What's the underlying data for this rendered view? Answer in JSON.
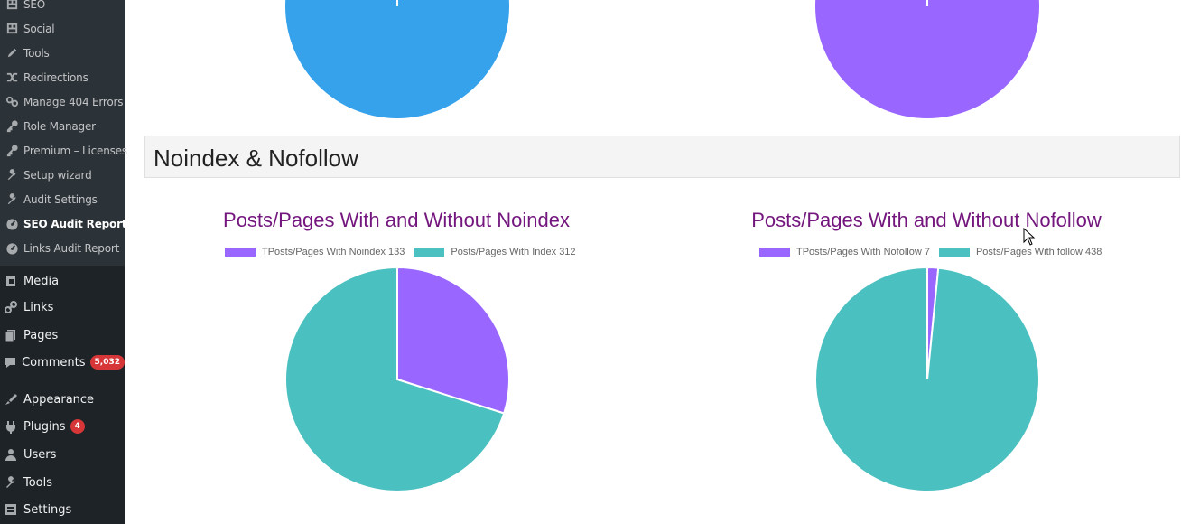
{
  "sidebar": {
    "submenu": [
      {
        "label": "SEO",
        "icon": "grid-icon"
      },
      {
        "label": "Social",
        "icon": "grid-icon"
      },
      {
        "label": "Tools",
        "icon": "pencil-icon"
      },
      {
        "label": "Redirections",
        "icon": "shuffle-icon"
      },
      {
        "label": "Manage 404 Errors",
        "icon": "broken-link-icon"
      },
      {
        "label": "Role Manager",
        "icon": "key-icon"
      },
      {
        "label": "Premium – Licenses",
        "icon": "key-icon"
      },
      {
        "label": "Setup wizard",
        "icon": "wrench-icon"
      },
      {
        "label": "Audit Settings",
        "icon": "wrench-icon"
      },
      {
        "label": "SEO Audit Report",
        "icon": "dashboard-icon",
        "current": true
      },
      {
        "label": "Links Audit Report",
        "icon": "dashboard-icon"
      }
    ],
    "menu": [
      {
        "label": "Media",
        "icon": "media-icon"
      },
      {
        "label": "Links",
        "icon": "link-icon"
      },
      {
        "label": "Pages",
        "icon": "pages-icon"
      },
      {
        "label": "Comments",
        "icon": "comment-icon",
        "badge": "5,032"
      },
      {
        "label": "Appearance",
        "icon": "brush-icon"
      },
      {
        "label": "Plugins",
        "icon": "plugin-icon",
        "badge": "4"
      },
      {
        "label": "Users",
        "icon": "user-icon"
      },
      {
        "label": "Tools",
        "icon": "wrench-icon"
      },
      {
        "label": "Settings",
        "icon": "settings-icon"
      }
    ]
  },
  "section": {
    "title": "Noindex & Nofollow"
  },
  "colors": {
    "blue": "#36a2eb",
    "purple": "#9966ff",
    "teal": "#4bc0c0",
    "title": "#73167d",
    "sidebar": "#1d2327",
    "submenu": "#2c3338",
    "badge": "#d63638"
  },
  "chart_data": [
    {
      "type": "pie",
      "title": "",
      "labels": [],
      "values": [
        1
      ],
      "colors": [
        "#36a2eb"
      ],
      "note_visible": "partial (cropped at top)"
    },
    {
      "type": "pie",
      "title": "",
      "labels": [],
      "values": [
        1
      ],
      "colors": [
        "#9966ff"
      ],
      "note_visible": "partial (cropped at top)"
    },
    {
      "type": "pie",
      "title": "Posts/Pages With and Without Noindex",
      "labels": [
        "TPosts/Pages With Noindex 133",
        "Posts/Pages With Index 312"
      ],
      "values": [
        133,
        312
      ],
      "colors": [
        "#9966ff",
        "#4bc0c0"
      ],
      "legend": "top"
    },
    {
      "type": "pie",
      "title": "Posts/Pages With and Without Nofollow",
      "labels": [
        "TPosts/Pages With Nofollow 7",
        "Posts/Pages With follow 438"
      ],
      "values": [
        7,
        438
      ],
      "colors": [
        "#9966ff",
        "#4bc0c0"
      ],
      "legend": "top"
    }
  ]
}
